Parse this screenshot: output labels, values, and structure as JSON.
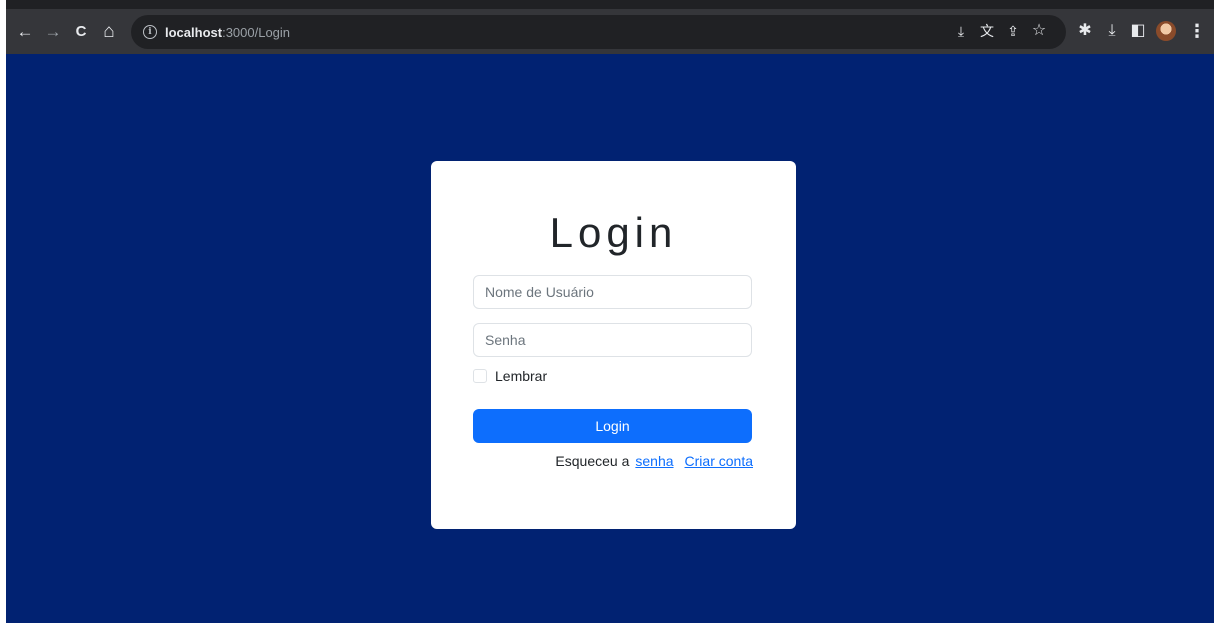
{
  "browser": {
    "url_host": "localhost",
    "url_path": ":3000/Login",
    "nav": {
      "back_icon": "←",
      "forward_icon": "→",
      "reload_icon": "C",
      "home_icon": "⌂"
    },
    "info_icon": "i",
    "toolbar_icons": {
      "install_icon": "⤓",
      "translate_icon": "文",
      "share_icon": "⇪",
      "bookmark_icon": "☆",
      "extensions_icon": "✱",
      "download_icon": "⤓",
      "sidepanel_icon": "◧",
      "menu_icon": "⋮"
    }
  },
  "page": {
    "background_color": "#012272",
    "card": {
      "title": "Login",
      "username_placeholder": "Nome de Usuário",
      "password_placeholder": "Senha",
      "remember_label": "Lembrar",
      "login_button": "Login",
      "forgot_prefix": "Esqueceu a",
      "forgot_link": "senha",
      "create_account_link": "Criar conta"
    },
    "primary_color": "#0d6efd"
  }
}
